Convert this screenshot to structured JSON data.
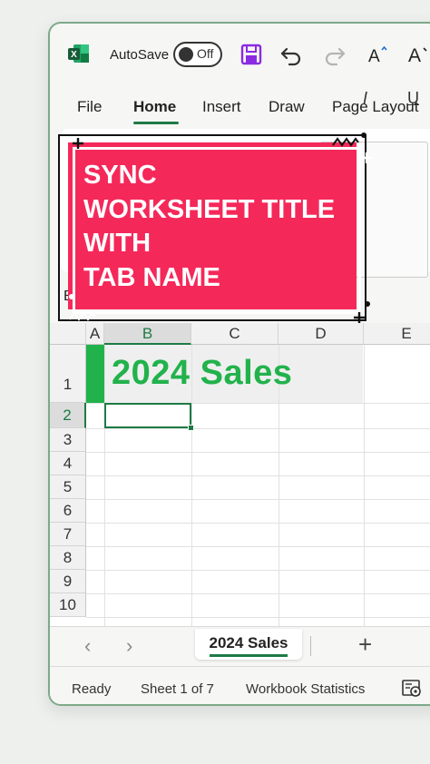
{
  "app": {
    "autosave_label": "AutoSave",
    "autosave_state": "Off",
    "icons": [
      "excel-logo-icon",
      "save-icon",
      "undo-icon",
      "redo-icon",
      "increase-font-icon",
      "decrease-font-icon"
    ]
  },
  "ribbon_tabs": [
    {
      "label": "File",
      "active": false
    },
    {
      "label": "Home",
      "active": true
    },
    {
      "label": "Insert",
      "active": false
    },
    {
      "label": "Draw",
      "active": false
    },
    {
      "label": "Page Layout",
      "active": false
    }
  ],
  "ribbon": {
    "italic_label": "I",
    "underline_label": "U",
    "namebox_partial": "B"
  },
  "grid": {
    "columns": [
      "A",
      "B",
      "C",
      "D",
      "E"
    ],
    "selected_column": "B",
    "rows": [
      "1",
      "2",
      "3",
      "4",
      "5",
      "6",
      "7",
      "8",
      "9",
      "10"
    ],
    "selected_row": "2",
    "title_cell_text": "2024 Sales"
  },
  "sheet_tabs": {
    "active": "2024 Sales",
    "add_label": "+"
  },
  "status": {
    "ready": "Ready",
    "sheet": "Sheet 1 of 7",
    "stats": "Workbook Statistics"
  },
  "promo": {
    "lines": [
      "SYNC",
      "WORKSHEET TITLE",
      "WITH",
      "TAB NAME"
    ],
    "background": "#f5285a"
  },
  "colors": {
    "accent_green": "#1e7a45",
    "title_green": "#22b24c",
    "save_purple": "#8a2be2"
  }
}
